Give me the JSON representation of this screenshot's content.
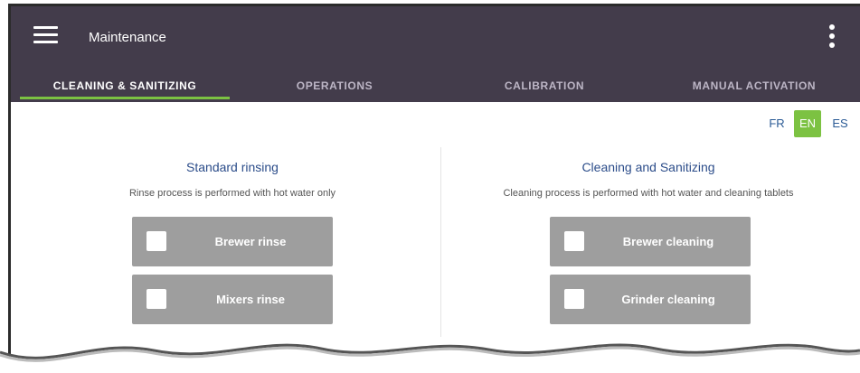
{
  "appbar": {
    "title": "Maintenance"
  },
  "tabs": [
    {
      "label": "CLEANING & SANITIZING",
      "active": true
    },
    {
      "label": "OPERATIONS",
      "active": false
    },
    {
      "label": "CALIBRATION",
      "active": false
    },
    {
      "label": "MANUAL ACTIVATION",
      "active": false
    }
  ],
  "languages": [
    {
      "code": "FR",
      "active": false
    },
    {
      "code": "EN",
      "active": true
    },
    {
      "code": "ES",
      "active": false
    }
  ],
  "rinsing": {
    "title": "Standard rinsing",
    "description": "Rinse process is performed with hot water only",
    "buttons": [
      {
        "label": "Brewer rinse"
      },
      {
        "label": "Mixers rinse"
      }
    ]
  },
  "cleaning": {
    "title": "Cleaning and Sanitizing",
    "description": "Cleaning process is performed with hot water and cleaning tablets",
    "buttons": [
      {
        "label": "Brewer cleaning"
      },
      {
        "label": "Grinder cleaning"
      }
    ]
  },
  "colors": {
    "appbar": "#433c4b",
    "accent": "#7cc242",
    "link_blue": "#2c4d8a",
    "button_gray": "#9e9e9e"
  },
  "icons": [
    "menu-icon",
    "more-vert-icon",
    "checkbox-icon"
  ]
}
